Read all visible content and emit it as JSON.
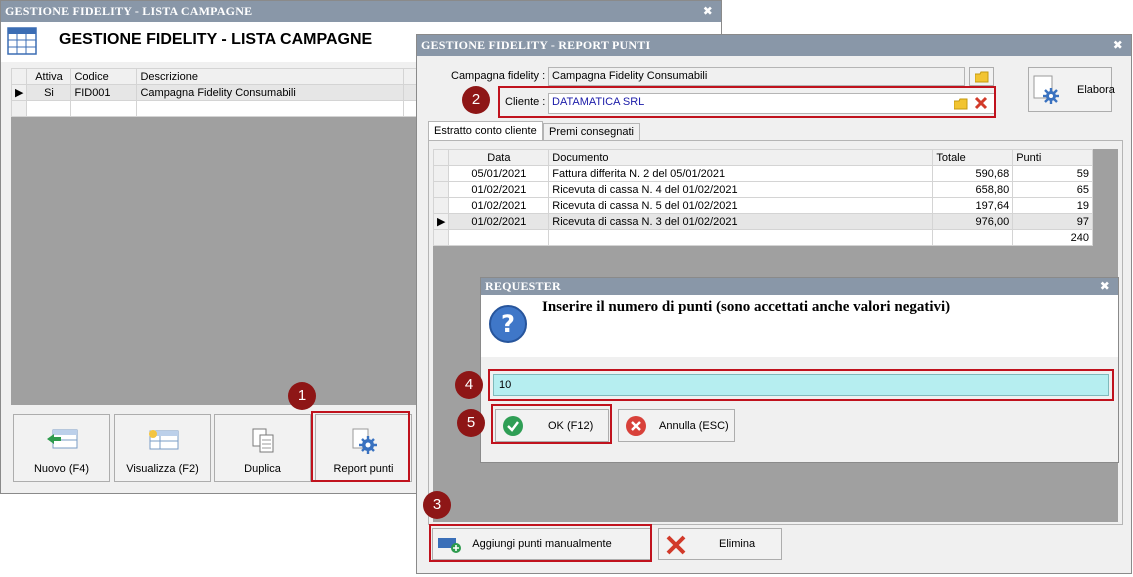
{
  "main_window": {
    "title": "GESTIONE FIDELITY - LISTA CAMPAGNE",
    "close_glyph": "✖",
    "header_title": "GESTIONE FIDELITY - LISTA CAMPAGNE",
    "header_icon": "table-icon",
    "columns": [
      "Attiva",
      "Codice",
      "Descrizione"
    ],
    "rows": [
      {
        "attiva": "Si",
        "codice": "FID001",
        "descrizione": "Campagna Fidelity Consumabili"
      }
    ],
    "buttons": {
      "nuovo": "Nuovo (F4)",
      "visualizza": "Visualizza (F2)",
      "duplica": "Duplica",
      "report": "Report punti"
    }
  },
  "report_window": {
    "title": "GESTIONE FIDELITY - REPORT PUNTI",
    "close_glyph": "✖",
    "campagna_label": "Campagna fidelity :",
    "campagna_value": "Campagna Fidelity Consumabili",
    "cliente_label": "Cliente :",
    "cliente_value": "DATAMATICA SRL",
    "elabora_label": "Elabora",
    "tabs": [
      "Estratto conto cliente",
      "Premi consegnati"
    ],
    "columns": [
      "Data",
      "Documento",
      "Totale",
      "Punti"
    ],
    "rows": [
      {
        "data": "05/01/2021",
        "documento": "Fattura differita N. 2 del 05/01/2021",
        "totale": "590,68",
        "punti": "59"
      },
      {
        "data": "01/02/2021",
        "documento": "Ricevuta di cassa N. 4 del 01/02/2021",
        "totale": "658,80",
        "punti": "65"
      },
      {
        "data": "01/02/2021",
        "documento": "Ricevuta di cassa N. 5 del 01/02/2021",
        "totale": "197,64",
        "punti": "19"
      },
      {
        "data": "01/02/2021",
        "documento": "Ricevuta di cassa N. 3 del 01/02/2021",
        "totale": "976,00",
        "punti": "97"
      }
    ],
    "total_punti": "240",
    "aggiungi_label": "Aggiungi punti manualmente",
    "elimina_label": "Elimina"
  },
  "requester": {
    "title": "REQUESTER",
    "close_glyph": "✖",
    "message": "Inserire il numero di punti (sono accettati anche valori negativi)",
    "input_value": "10",
    "ok_label": "OK (F12)",
    "annulla_label": "Annulla (ESC)"
  },
  "callouts": [
    "1",
    "2",
    "3",
    "4",
    "5"
  ],
  "colors": {
    "titlebar": "#8997a8",
    "highlight": "#c0121d",
    "badge": "#8e1616",
    "input_bg": "#b6eef0",
    "client_text": "#1a1aa8"
  }
}
